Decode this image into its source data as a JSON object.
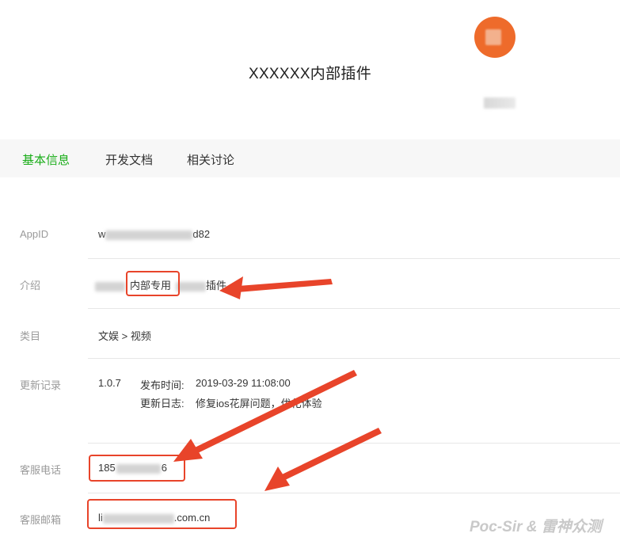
{
  "header": {
    "plugin_name": "XXXXXX内部插件"
  },
  "tabs": [
    {
      "label": "基本信息",
      "active": true
    },
    {
      "label": "开发文档",
      "active": false
    },
    {
      "label": "相关讨论",
      "active": false
    }
  ],
  "info": {
    "appid": {
      "label": "AppID",
      "value_start": "w",
      "value_end": "d82"
    },
    "intro": {
      "label": "介绍",
      "highlight": "内部专用",
      "suffix": "插件"
    },
    "category": {
      "label": "类目",
      "value": "文娱 > 视频"
    },
    "update": {
      "label": "更新记录",
      "version": "1.0.7",
      "publish_time_label": "发布时间:",
      "publish_time": "2019-03-29 11:08:00",
      "log_label": "更新日志:",
      "log_value": "修复ios花屏问题，优化体验"
    },
    "phone": {
      "label": "客服电话",
      "value_start": "185",
      "value_end": "6"
    },
    "email": {
      "label": "客服邮箱",
      "value_start": "li",
      "value_end": ".com.cn"
    }
  },
  "watermark": "Poc-Sir & 雷神众测",
  "colors": {
    "accent": "#1aad19",
    "annotation_red": "#e8442a",
    "avatar": "#ee6b2b"
  }
}
